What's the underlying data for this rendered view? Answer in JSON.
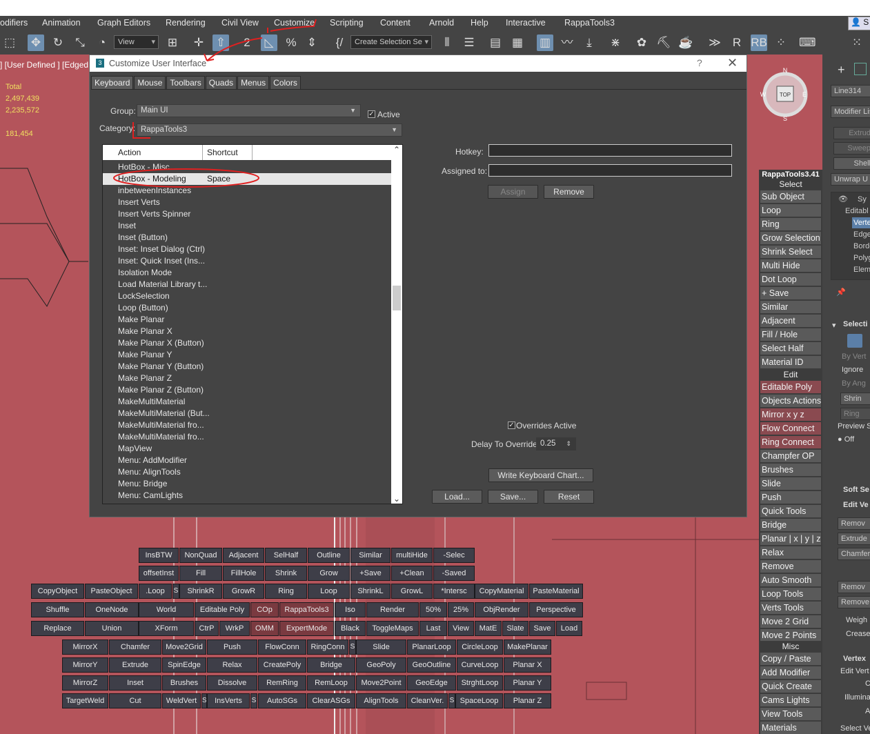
{
  "menubar": {
    "items": [
      "odifiers",
      "Animation",
      "Graph Editors",
      "Rendering",
      "Civil View",
      "Customize",
      "Scripting",
      "Content",
      "Arnold",
      "Help",
      "Interactive",
      "RappaTools3"
    ],
    "user_label": "S"
  },
  "toolbar": {
    "view_drop": "View",
    "selection_set_drop": "Create Selection Se"
  },
  "viewport": {
    "label": "] [User Defined ] [Edged",
    "stats": {
      "total_label": "Total",
      "v1": "2,497,439",
      "v2": "2,235,572",
      "v3": "181,454"
    },
    "gizmo_top": "TOP",
    "gizmo_n": "N",
    "gizmo_s": "S",
    "gizmo_e": "E",
    "gizmo_w": "W"
  },
  "dialog": {
    "title": "Customize User Interface",
    "help": "?",
    "close": "✕",
    "tabs": [
      "Keyboard",
      "Mouse",
      "Toolbars",
      "Quads",
      "Menus",
      "Colors"
    ],
    "group_label": "Group:",
    "group_value": "Main UI",
    "active_label": "Active",
    "category_label": "Category:",
    "category_value": "RappaTools3",
    "list_headers": {
      "action": "Action",
      "shortcut": "Shortcut"
    },
    "actions": [
      {
        "action": "HotBox - Misc",
        "shortcut": ""
      },
      {
        "action": "HotBox - Modeling",
        "shortcut": "Space"
      },
      {
        "action": "inbetweenInstances",
        "shortcut": ""
      },
      {
        "action": "Insert Verts",
        "shortcut": ""
      },
      {
        "action": "Insert Verts Spinner",
        "shortcut": ""
      },
      {
        "action": "Inset",
        "shortcut": ""
      },
      {
        "action": "Inset (Button)",
        "shortcut": ""
      },
      {
        "action": "Inset: Inset Dialog (Ctrl)",
        "shortcut": ""
      },
      {
        "action": "Inset: Quick Inset (Ins...",
        "shortcut": ""
      },
      {
        "action": "Isolation Mode",
        "shortcut": ""
      },
      {
        "action": "Load Material Library t...",
        "shortcut": ""
      },
      {
        "action": "LockSelection",
        "shortcut": ""
      },
      {
        "action": "Loop (Button)",
        "shortcut": ""
      },
      {
        "action": "Make Planar",
        "shortcut": ""
      },
      {
        "action": "Make Planar X",
        "shortcut": ""
      },
      {
        "action": "Make Planar X (Button)",
        "shortcut": ""
      },
      {
        "action": "Make Planar Y",
        "shortcut": ""
      },
      {
        "action": "Make Planar Y (Button)",
        "shortcut": ""
      },
      {
        "action": "Make Planar Z",
        "shortcut": ""
      },
      {
        "action": "Make Planar Z (Button)",
        "shortcut": ""
      },
      {
        "action": "MakeMultiMaterial",
        "shortcut": ""
      },
      {
        "action": "MakeMultiMaterial (But...",
        "shortcut": ""
      },
      {
        "action": "MakeMultiMaterial fro...",
        "shortcut": ""
      },
      {
        "action": "MakeMultiMaterial fro...",
        "shortcut": ""
      },
      {
        "action": "MapView",
        "shortcut": ""
      },
      {
        "action": "Menu: AddModifier",
        "shortcut": ""
      },
      {
        "action": "Menu: AlignTools",
        "shortcut": ""
      },
      {
        "action": "Menu: Bridge",
        "shortcut": ""
      },
      {
        "action": "Menu: CamLights",
        "shortcut": ""
      }
    ],
    "hotkey_label": "Hotkey:",
    "assigned_label": "Assigned to:",
    "assign_btn": "Assign",
    "remove_btn": "Remove",
    "overrides_label": "Overrides Active",
    "delay_label": "Delay To Override:",
    "delay_value": "0.25",
    "write_chart_btn": "Write Keyboard Chart...",
    "load_btn": "Load...",
    "save_btn": "Save...",
    "reset_btn": "Reset"
  },
  "rappa": {
    "title": "RappaTools3.41",
    "select_header": "Select",
    "select_items": [
      "Sub Object",
      "Loop",
      "Ring",
      "Grow Selection",
      "Shrink Select",
      "Multi Hide",
      "Dot Loop",
      "+ Save",
      "Similar",
      "Adjacent",
      "Fill / Hole",
      "Select Half",
      "Material ID"
    ],
    "edit_header": "Edit",
    "edit_items": [
      "Editable Poly",
      "Objects Actions",
      "Mirror   x  y  z",
      "Flow Connect",
      "Ring Connect",
      "Champfer OP",
      "Brushes",
      "Slide",
      "Push",
      "Quick Tools",
      "Bridge",
      "Planar | x | y | z",
      "Relax",
      "Remove",
      "Auto Smooth",
      "Loop Tools",
      "Verts Tools",
      "Move 2 Grid",
      "Move 2 Points"
    ],
    "misc_header": "Misc",
    "misc_items": [
      "Copy / Paste",
      "Add Modifier",
      "Quick Create",
      "Cams Lights",
      "View Tools",
      "Materials"
    ]
  },
  "cmd": {
    "obj_name": "Line314",
    "modlist": "Modifier Lis",
    "btns": [
      "Extrud",
      "Sweep",
      "Shell",
      "Unwrap U"
    ],
    "stack": [
      "Sy",
      "Editabl",
      "Verte",
      "Edge",
      "Borde",
      "Polyg",
      "Elem"
    ],
    "selection_roll": "Selecti",
    "by_vert": "By Vert",
    "ignore": "Ignore",
    "by_angle": "By Ang",
    "shrink": "Shrin",
    "ring": "Ring",
    "preview": "Preview S",
    "off": "Off",
    "soft_sel": "Soft Se",
    "edit_verts": "Edit Ve",
    "remove": "Remov",
    "extrude": "Extrude",
    "chamfer": "Chamfer",
    "remove2": "Remov",
    "remove3": "Remove",
    "weight": "Weigh",
    "crease": "Crease",
    "vertex_roll": "Vertex",
    "edit_vert": "Edit Vert",
    "c": "C",
    "illum": "Illumina",
    "a": "A",
    "select_ve": "Select Ve"
  },
  "hotbox": {
    "rows": [
      [
        {
          "t": "InsBTW"
        },
        {
          "t": "NonQuad"
        },
        {
          "t": "Adjacent"
        },
        {
          "t": "SelHalf"
        },
        {
          "t": "Outline"
        },
        {
          "t": "Similar"
        },
        {
          "t": "multiHide"
        },
        {
          "t": "-Selec"
        }
      ],
      [
        {
          "t": "offsetInst"
        },
        {
          "t": "Fill"
        },
        {
          "t": "FillHole"
        },
        {
          "t": "Shrink"
        },
        {
          "t": "Grow"
        },
        {
          "t": "+Save"
        },
        {
          "t": "+Clean"
        },
        {
          "t": "-Saved"
        }
      ],
      [
        {
          "t": "CopyObject"
        },
        {
          "t": "PasteObject"
        },
        {
          "t": ".Loop"
        },
        {
          "t": "S"
        },
        {
          "t": "ShrinkR"
        },
        {
          "t": "GrowR"
        },
        {
          "t": "Ring"
        },
        {
          "t": "Loop"
        },
        {
          "t": "ShrinkL"
        },
        {
          "t": "GrowL"
        },
        {
          "t": "*Intersc"
        },
        {
          "t": "CopyMaterial"
        },
        {
          "t": "PasteMaterial"
        }
      ],
      [
        {
          "t": "Shuffle"
        },
        {
          "t": "OneNode"
        },
        {
          "t": "World"
        },
        {
          "t": "Editable Poly"
        },
        {
          "t": "COp"
        },
        {
          "t": "RappaTools3"
        },
        {
          "t": "Iso"
        },
        {
          "t": "Render"
        },
        {
          "t": "50%"
        },
        {
          "t": "25%"
        },
        {
          "t": "ObjRender"
        },
        {
          "t": "Perspective"
        }
      ],
      [
        {
          "t": "Replace"
        },
        {
          "t": "Union"
        },
        {
          "t": "XForm"
        },
        {
          "t": "CtrP"
        },
        {
          "t": "WrkP"
        },
        {
          "t": "OMM"
        },
        {
          "t": "ExpertMode"
        },
        {
          "t": "Black"
        },
        {
          "t": "ToggleMaps"
        },
        {
          "t": "Last"
        },
        {
          "t": "View"
        },
        {
          "t": "MatE"
        },
        {
          "t": "Slate"
        },
        {
          "t": "Save"
        },
        {
          "t": "Load"
        }
      ],
      [
        {
          "t": "MirrorX"
        },
        {
          "t": "Chamfer"
        },
        {
          "t": "Move2Grid"
        },
        {
          "t": "Push"
        },
        {
          "t": "FlowConn"
        },
        {
          "t": "RingConn"
        },
        {
          "t": "S"
        },
        {
          "t": "Slide"
        },
        {
          "t": "PlanarLoop"
        },
        {
          "t": "CircleLoop"
        },
        {
          "t": "MakePlanar"
        }
      ],
      [
        {
          "t": "MirrorY"
        },
        {
          "t": "Extrude"
        },
        {
          "t": "SpinEdge"
        },
        {
          "t": "Relax"
        },
        {
          "t": "CreatePoly"
        },
        {
          "t": "Bridge"
        },
        {
          "t": "GeoPoly"
        },
        {
          "t": "GeoOutline"
        },
        {
          "t": "CurveLoop"
        },
        {
          "t": "Planar X"
        }
      ],
      [
        {
          "t": "MirrorZ"
        },
        {
          "t": "Inset"
        },
        {
          "t": "Brushes"
        },
        {
          "t": "Dissolve"
        },
        {
          "t": "RemRing"
        },
        {
          "t": "RemLoop"
        },
        {
          "t": "Move2Point"
        },
        {
          "t": "GeoEdge"
        },
        {
          "t": "StrghtLoop"
        },
        {
          "t": "Planar Y"
        }
      ],
      [
        {
          "t": "TargetWeld"
        },
        {
          "t": "Cut"
        },
        {
          "t": "WeldVert"
        },
        {
          "t": "S"
        },
        {
          "t": "InsVerts"
        },
        {
          "t": "S"
        },
        {
          "t": "AutoSGs"
        },
        {
          "t": "ClearASGs"
        },
        {
          "t": "AlignTools"
        },
        {
          "t": "CleanVer."
        },
        {
          "t": "S"
        },
        {
          "t": "SpaceLoop"
        },
        {
          "t": "Planar Z"
        }
      ]
    ]
  }
}
